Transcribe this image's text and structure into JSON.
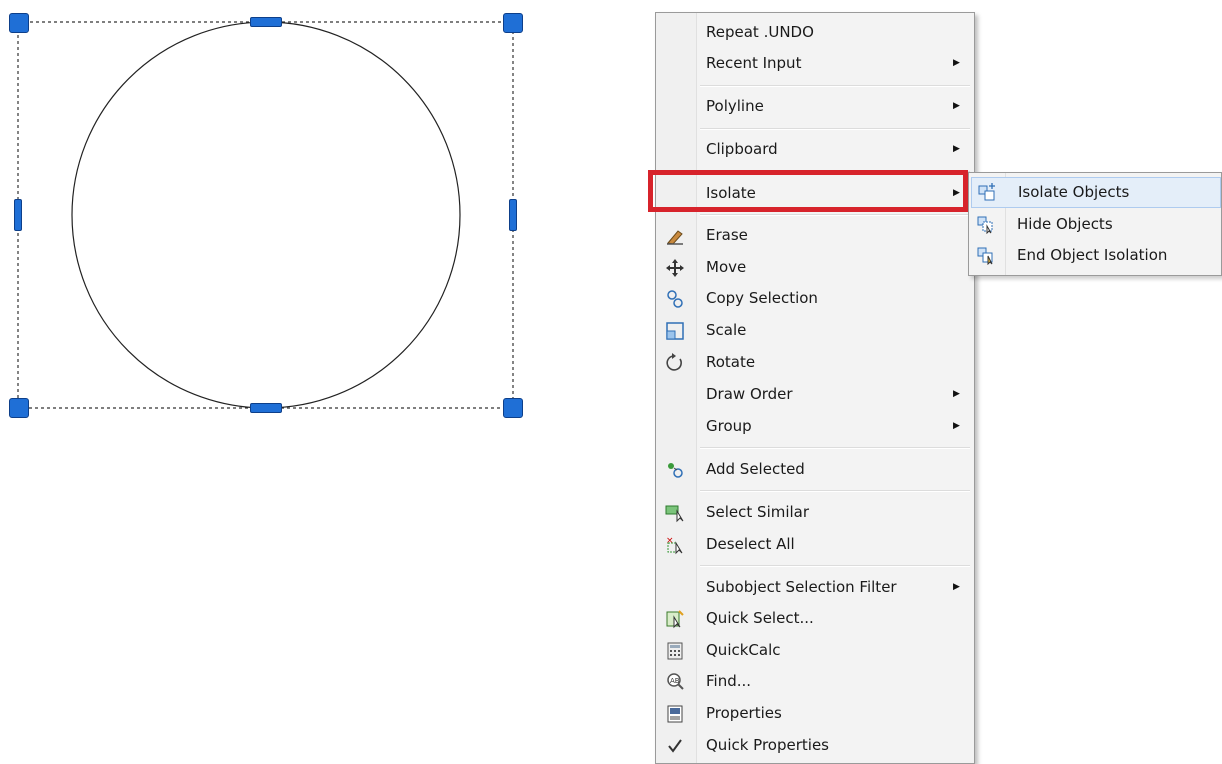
{
  "menu": {
    "items": [
      {
        "label": "Repeat .UNDO",
        "icon": "",
        "submenu": false
      },
      {
        "label": "Recent Input",
        "icon": "",
        "submenu": true
      },
      {
        "label": "Polyline",
        "icon": "",
        "submenu": true
      },
      {
        "label": "Clipboard",
        "icon": "",
        "submenu": true
      },
      {
        "label": "Isolate",
        "icon": "",
        "submenu": true,
        "highlighted": true
      },
      {
        "label": "Erase",
        "icon": "erase-icon",
        "submenu": false
      },
      {
        "label": "Move",
        "icon": "move-icon",
        "submenu": false
      },
      {
        "label": "Copy Selection",
        "icon": "copy-selection-icon",
        "submenu": false
      },
      {
        "label": "Scale",
        "icon": "scale-icon",
        "submenu": false
      },
      {
        "label": "Rotate",
        "icon": "rotate-icon",
        "submenu": false
      },
      {
        "label": "Draw Order",
        "icon": "",
        "submenu": true
      },
      {
        "label": "Group",
        "icon": "",
        "submenu": true
      },
      {
        "label": "Add Selected",
        "icon": "add-selected-icon",
        "submenu": false
      },
      {
        "label": "Select Similar",
        "icon": "select-similar-icon",
        "submenu": false
      },
      {
        "label": "Deselect All",
        "icon": "deselect-all-icon",
        "submenu": false
      },
      {
        "label": "Subobject Selection Filter",
        "icon": "",
        "submenu": true
      },
      {
        "label": "Quick Select...",
        "icon": "quick-select-icon",
        "submenu": false
      },
      {
        "label": "QuickCalc",
        "icon": "calculator-icon",
        "submenu": false
      },
      {
        "label": "Find...",
        "icon": "find-icon",
        "submenu": false
      },
      {
        "label": "Properties",
        "icon": "properties-icon",
        "submenu": false
      },
      {
        "label": "Quick Properties",
        "icon": "checkmark-icon",
        "submenu": false,
        "checked": true
      }
    ]
  },
  "submenu": {
    "items": [
      {
        "label": "Isolate Objects",
        "icon": "isolate-objects-icon",
        "hover": true
      },
      {
        "label": "Hide Objects",
        "icon": "hide-objects-icon"
      },
      {
        "label": "End Object Isolation",
        "icon": "end-isolation-icon"
      }
    ]
  },
  "colors": {
    "grip": "#1f6fd6",
    "highlight": "#d7232b",
    "menu_bg": "#f3f3f3"
  }
}
